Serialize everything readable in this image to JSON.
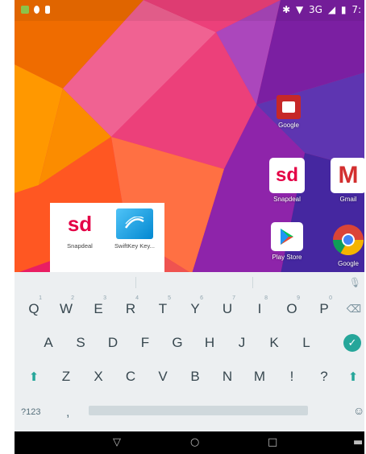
{
  "status_bar": {
    "signal_text": "3G",
    "time": "7:"
  },
  "home": {
    "google_folder": {
      "label": "Google"
    },
    "apps": [
      {
        "label": "Snapdeal",
        "icon": "snapdeal-icon",
        "text": "sd"
      },
      {
        "label": "Gmail",
        "icon": "gmail-icon",
        "text": "M"
      },
      {
        "label": "Play Store",
        "icon": "play-store-icon"
      },
      {
        "label": "Google",
        "icon": "chrome-icon"
      }
    ]
  },
  "popup": {
    "items": [
      {
        "label": "Snapdeal",
        "icon_text": "sd"
      },
      {
        "label": "SwiftKey Key..."
      }
    ]
  },
  "keyboard": {
    "row1": [
      {
        "key": "Q",
        "hint": "1"
      },
      {
        "key": "W",
        "hint": "2"
      },
      {
        "key": "E",
        "hint": "3"
      },
      {
        "key": "R",
        "hint": "4"
      },
      {
        "key": "T",
        "hint": "5"
      },
      {
        "key": "Y",
        "hint": "6"
      },
      {
        "key": "U",
        "hint": "7"
      },
      {
        "key": "I",
        "hint": "8"
      },
      {
        "key": "O",
        "hint": "9"
      },
      {
        "key": "P",
        "hint": "0"
      }
    ],
    "row2": [
      "A",
      "S",
      "D",
      "F",
      "G",
      "H",
      "J",
      "K",
      "L"
    ],
    "row3": [
      "Z",
      "X",
      "C",
      "V",
      "B",
      "N",
      "M",
      "!",
      "?"
    ],
    "symbols_key": "?123",
    "comma_key": ","
  },
  "colors": {
    "accent": "#26a69a",
    "snapdeal_red": "#e40046"
  }
}
